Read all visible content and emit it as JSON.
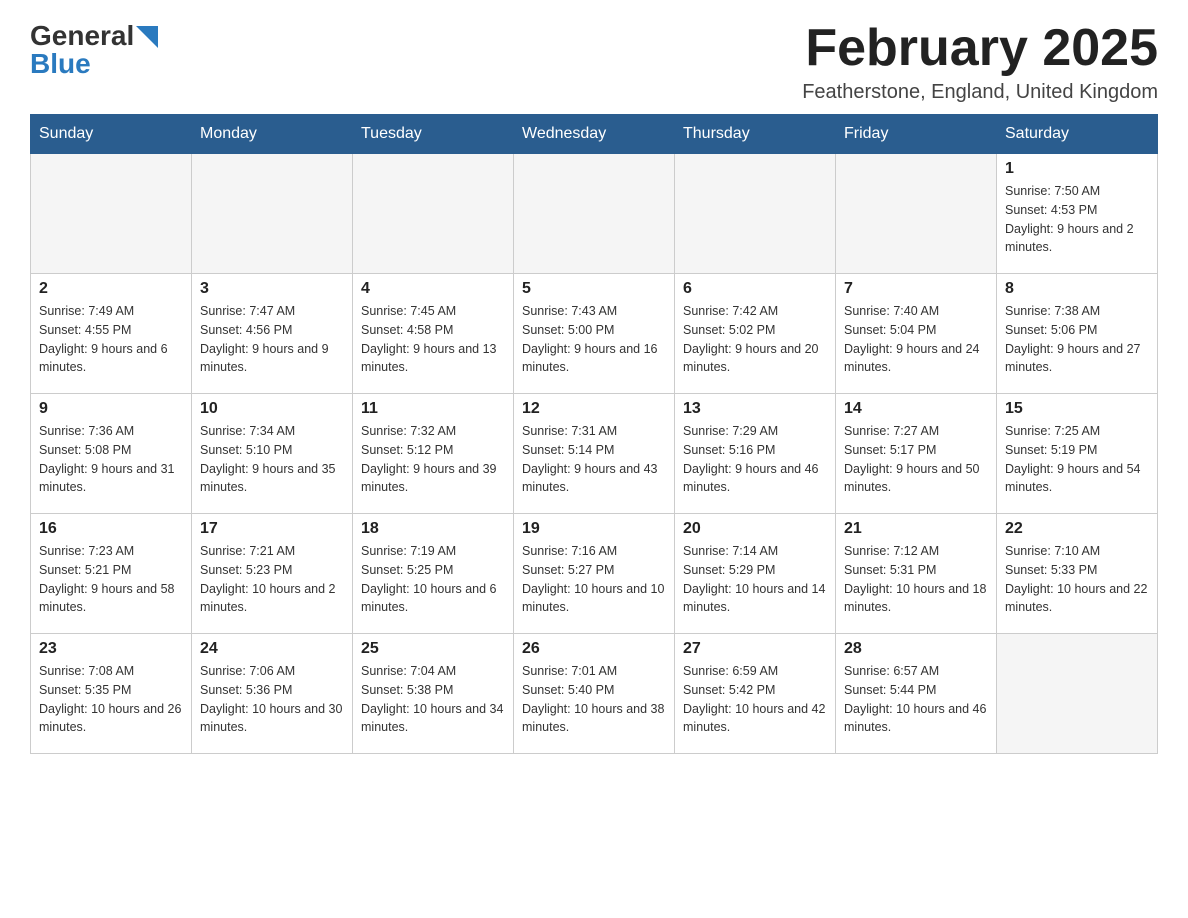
{
  "logo": {
    "general": "General",
    "blue": "Blue",
    "arrow": "▶"
  },
  "header": {
    "month_title": "February 2025",
    "location": "Featherstone, England, United Kingdom"
  },
  "days_of_week": [
    "Sunday",
    "Monday",
    "Tuesday",
    "Wednesday",
    "Thursday",
    "Friday",
    "Saturday"
  ],
  "weeks": [
    [
      {
        "day": "",
        "sunrise": "",
        "sunset": "",
        "daylight": ""
      },
      {
        "day": "",
        "sunrise": "",
        "sunset": "",
        "daylight": ""
      },
      {
        "day": "",
        "sunrise": "",
        "sunset": "",
        "daylight": ""
      },
      {
        "day": "",
        "sunrise": "",
        "sunset": "",
        "daylight": ""
      },
      {
        "day": "",
        "sunrise": "",
        "sunset": "",
        "daylight": ""
      },
      {
        "day": "",
        "sunrise": "",
        "sunset": "",
        "daylight": ""
      },
      {
        "day": "1",
        "sunrise": "Sunrise: 7:50 AM",
        "sunset": "Sunset: 4:53 PM",
        "daylight": "Daylight: 9 hours and 2 minutes."
      }
    ],
    [
      {
        "day": "2",
        "sunrise": "Sunrise: 7:49 AM",
        "sunset": "Sunset: 4:55 PM",
        "daylight": "Daylight: 9 hours and 6 minutes."
      },
      {
        "day": "3",
        "sunrise": "Sunrise: 7:47 AM",
        "sunset": "Sunset: 4:56 PM",
        "daylight": "Daylight: 9 hours and 9 minutes."
      },
      {
        "day": "4",
        "sunrise": "Sunrise: 7:45 AM",
        "sunset": "Sunset: 4:58 PM",
        "daylight": "Daylight: 9 hours and 13 minutes."
      },
      {
        "day": "5",
        "sunrise": "Sunrise: 7:43 AM",
        "sunset": "Sunset: 5:00 PM",
        "daylight": "Daylight: 9 hours and 16 minutes."
      },
      {
        "day": "6",
        "sunrise": "Sunrise: 7:42 AM",
        "sunset": "Sunset: 5:02 PM",
        "daylight": "Daylight: 9 hours and 20 minutes."
      },
      {
        "day": "7",
        "sunrise": "Sunrise: 7:40 AM",
        "sunset": "Sunset: 5:04 PM",
        "daylight": "Daylight: 9 hours and 24 minutes."
      },
      {
        "day": "8",
        "sunrise": "Sunrise: 7:38 AM",
        "sunset": "Sunset: 5:06 PM",
        "daylight": "Daylight: 9 hours and 27 minutes."
      }
    ],
    [
      {
        "day": "9",
        "sunrise": "Sunrise: 7:36 AM",
        "sunset": "Sunset: 5:08 PM",
        "daylight": "Daylight: 9 hours and 31 minutes."
      },
      {
        "day": "10",
        "sunrise": "Sunrise: 7:34 AM",
        "sunset": "Sunset: 5:10 PM",
        "daylight": "Daylight: 9 hours and 35 minutes."
      },
      {
        "day": "11",
        "sunrise": "Sunrise: 7:32 AM",
        "sunset": "Sunset: 5:12 PM",
        "daylight": "Daylight: 9 hours and 39 minutes."
      },
      {
        "day": "12",
        "sunrise": "Sunrise: 7:31 AM",
        "sunset": "Sunset: 5:14 PM",
        "daylight": "Daylight: 9 hours and 43 minutes."
      },
      {
        "day": "13",
        "sunrise": "Sunrise: 7:29 AM",
        "sunset": "Sunset: 5:16 PM",
        "daylight": "Daylight: 9 hours and 46 minutes."
      },
      {
        "day": "14",
        "sunrise": "Sunrise: 7:27 AM",
        "sunset": "Sunset: 5:17 PM",
        "daylight": "Daylight: 9 hours and 50 minutes."
      },
      {
        "day": "15",
        "sunrise": "Sunrise: 7:25 AM",
        "sunset": "Sunset: 5:19 PM",
        "daylight": "Daylight: 9 hours and 54 minutes."
      }
    ],
    [
      {
        "day": "16",
        "sunrise": "Sunrise: 7:23 AM",
        "sunset": "Sunset: 5:21 PM",
        "daylight": "Daylight: 9 hours and 58 minutes."
      },
      {
        "day": "17",
        "sunrise": "Sunrise: 7:21 AM",
        "sunset": "Sunset: 5:23 PM",
        "daylight": "Daylight: 10 hours and 2 minutes."
      },
      {
        "day": "18",
        "sunrise": "Sunrise: 7:19 AM",
        "sunset": "Sunset: 5:25 PM",
        "daylight": "Daylight: 10 hours and 6 minutes."
      },
      {
        "day": "19",
        "sunrise": "Sunrise: 7:16 AM",
        "sunset": "Sunset: 5:27 PM",
        "daylight": "Daylight: 10 hours and 10 minutes."
      },
      {
        "day": "20",
        "sunrise": "Sunrise: 7:14 AM",
        "sunset": "Sunset: 5:29 PM",
        "daylight": "Daylight: 10 hours and 14 minutes."
      },
      {
        "day": "21",
        "sunrise": "Sunrise: 7:12 AM",
        "sunset": "Sunset: 5:31 PM",
        "daylight": "Daylight: 10 hours and 18 minutes."
      },
      {
        "day": "22",
        "sunrise": "Sunrise: 7:10 AM",
        "sunset": "Sunset: 5:33 PM",
        "daylight": "Daylight: 10 hours and 22 minutes."
      }
    ],
    [
      {
        "day": "23",
        "sunrise": "Sunrise: 7:08 AM",
        "sunset": "Sunset: 5:35 PM",
        "daylight": "Daylight: 10 hours and 26 minutes."
      },
      {
        "day": "24",
        "sunrise": "Sunrise: 7:06 AM",
        "sunset": "Sunset: 5:36 PM",
        "daylight": "Daylight: 10 hours and 30 minutes."
      },
      {
        "day": "25",
        "sunrise": "Sunrise: 7:04 AM",
        "sunset": "Sunset: 5:38 PM",
        "daylight": "Daylight: 10 hours and 34 minutes."
      },
      {
        "day": "26",
        "sunrise": "Sunrise: 7:01 AM",
        "sunset": "Sunset: 5:40 PM",
        "daylight": "Daylight: 10 hours and 38 minutes."
      },
      {
        "day": "27",
        "sunrise": "Sunrise: 6:59 AM",
        "sunset": "Sunset: 5:42 PM",
        "daylight": "Daylight: 10 hours and 42 minutes."
      },
      {
        "day": "28",
        "sunrise": "Sunrise: 6:57 AM",
        "sunset": "Sunset: 5:44 PM",
        "daylight": "Daylight: 10 hours and 46 minutes."
      },
      {
        "day": "",
        "sunrise": "",
        "sunset": "",
        "daylight": ""
      }
    ]
  ]
}
